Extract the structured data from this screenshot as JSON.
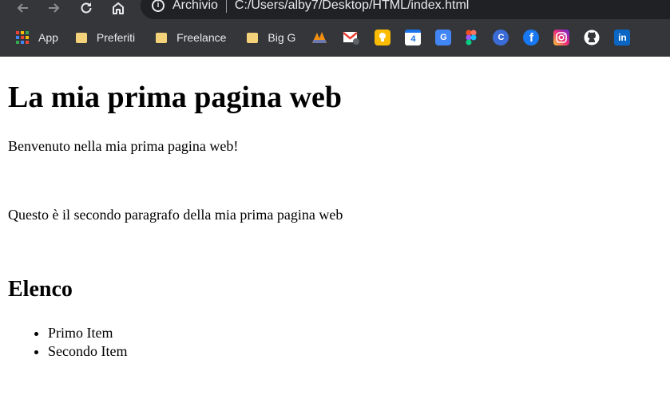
{
  "browser": {
    "address": {
      "scheme_label": "Archivio",
      "url": "C:/Users/alby7/Desktop/HTML/index.html"
    },
    "bookmarks": [
      {
        "label": "App",
        "icon": "apps-grid-icon"
      },
      {
        "label": "Preferiti",
        "icon": "folder-icon"
      },
      {
        "label": "Freelance",
        "icon": "folder-icon"
      },
      {
        "label": "Big G",
        "icon": "folder-icon"
      }
    ],
    "shortcut_icons": [
      "pma-icon",
      "gmail-icon",
      "keep-icon",
      "calendar-icon",
      "translate-icon",
      "figma-icon",
      "canva-icon",
      "facebook-icon",
      "instagram-icon",
      "github-icon",
      "linkedin-icon"
    ],
    "calendar_day": "4",
    "canva_letter": "C",
    "facebook_letter": "f",
    "linkedin_letters": "in",
    "translate_letters": "G"
  },
  "page": {
    "heading": "La mia prima pagina web",
    "paragraph_1": "Benvenuto nella mia prima pagina web!",
    "paragraph_2": "Questo è il secondo paragrafo della mia prima pagina web",
    "list_heading": "Elenco",
    "list_items": [
      "Primo Item",
      "Secondo Item"
    ]
  }
}
